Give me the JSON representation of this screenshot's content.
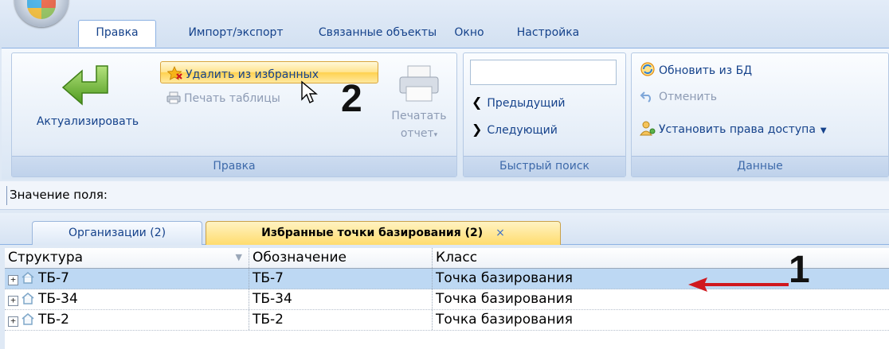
{
  "ribbon_tabs": [
    "Правка",
    "Импорт/экспорт",
    "Связанные объекты",
    "Окно",
    "Настройка"
  ],
  "active_tab_index": 0,
  "groups": {
    "edit": {
      "label": "Правка",
      "refresh_label": "Актуализировать",
      "remove_favorites_label": "Удалить из избранных",
      "print_table_label": "Печать таблицы",
      "print_report_line1": "Печатать",
      "print_report_line2": "отчет"
    },
    "quick_search": {
      "label": "Быстрый поиск",
      "input_value": "",
      "prev_label": "Предыдущий",
      "next_label": "Следующий"
    },
    "data": {
      "label": "Данные",
      "update_label": "Обновить из БД",
      "cancel_label": "Отменить",
      "rights_label": "Установить права доступа"
    }
  },
  "field_value_label": "Значение поля:",
  "doc_tabs": [
    {
      "label": "Организации (2)"
    },
    {
      "label": "Избранные точки базирования (2)",
      "active": true
    }
  ],
  "doc_tab_close_glyph": "×",
  "grid": {
    "columns": [
      "Структура",
      "Обозначение",
      "Класс"
    ],
    "rows": [
      {
        "structure": "ТБ-7",
        "designation": "ТБ-7",
        "class": "Точка базирования",
        "selected": true
      },
      {
        "structure": "ТБ-34",
        "designation": "ТБ-34",
        "class": "Точка базирования"
      },
      {
        "structure": "ТБ-2",
        "designation": "ТБ-2",
        "class": "Точка базирования"
      }
    ]
  },
  "annotations": {
    "marker1": "1",
    "marker2": "2"
  },
  "colors": {
    "accent": "#15428b",
    "selection": "#bdd8f3",
    "highlight": "#ffd24f",
    "arrow": "#d0181e"
  }
}
